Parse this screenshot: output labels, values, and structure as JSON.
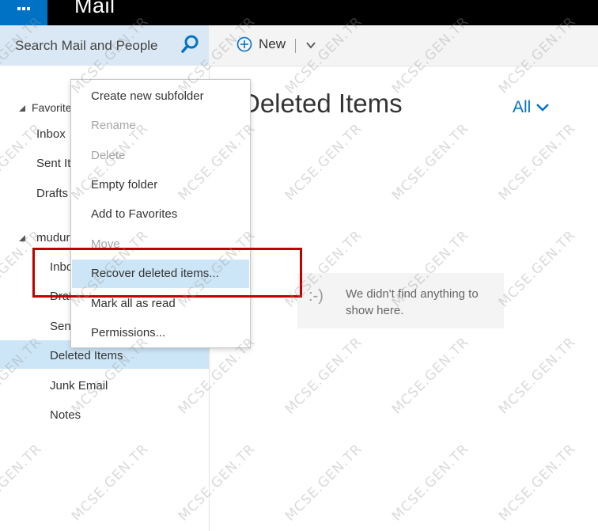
{
  "app": {
    "title": "Mail"
  },
  "search": {
    "placeholder": "Search Mail and People"
  },
  "toolbar": {
    "new_label": "New",
    "divider": "|"
  },
  "folders": {
    "favorites_label": "Favorite",
    "favorites_items": [
      "Inbox",
      "Sent It",
      "Drafts"
    ],
    "account_label": "mudur",
    "account_items": [
      "Inbo",
      "Draf",
      "Sen",
      "Deleted Items",
      "Junk Email",
      "Notes"
    ]
  },
  "content": {
    "title": "Deleted Items",
    "filter_label": "All",
    "empty_face": ":-)",
    "empty_message": "We didn't find anything to show here."
  },
  "context_menu": {
    "items": [
      {
        "label": "Create new subfolder",
        "disabled": false
      },
      {
        "label": "Rename",
        "disabled": true
      },
      {
        "label": "Delete",
        "disabled": true
      },
      {
        "label": "Empty folder",
        "disabled": false
      },
      {
        "label": "Add to Favorites",
        "disabled": false
      },
      {
        "label": "Move",
        "disabled": true
      },
      {
        "label": "Recover deleted items...",
        "disabled": false,
        "hovered": true
      },
      {
        "label": "Mark all as read",
        "disabled": false
      },
      {
        "label": "Permissions...",
        "disabled": false
      }
    ]
  },
  "watermark": {
    "text": "MCSE.GEN.TR"
  },
  "colors": {
    "accent": "#0072c6",
    "selected": "#cde6f7",
    "annotation": "#c00000"
  },
  "icons": {
    "app_launcher": "waffle-icon",
    "search": "search-icon",
    "new": "plus-circle-icon",
    "dropdown": "chevron-down-icon"
  }
}
